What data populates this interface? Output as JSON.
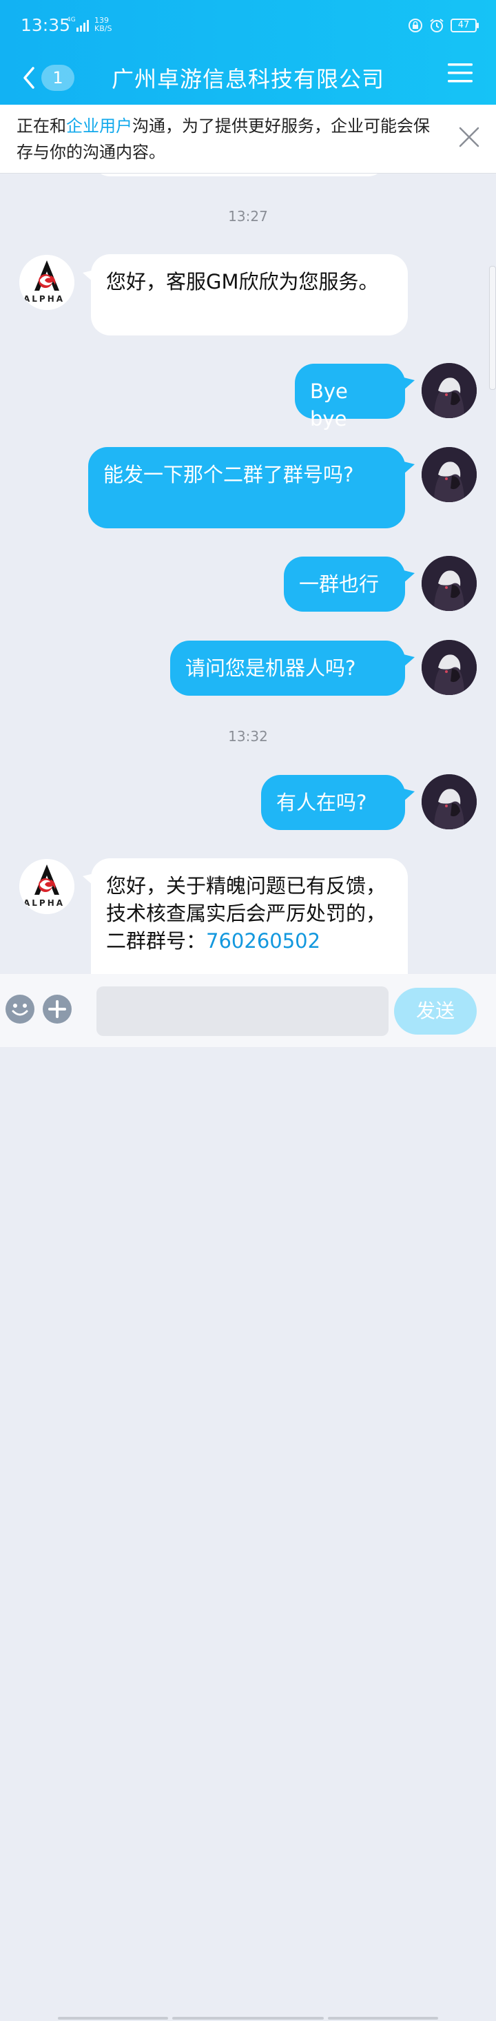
{
  "status_bar": {
    "time": "13:35",
    "network": "4G",
    "speed_value": "139",
    "speed_unit": "KB/S",
    "battery": "47"
  },
  "header": {
    "unread_count": "1",
    "title": "广州卓游信息科技有限公司",
    "color": "#16bdf5"
  },
  "notice": {
    "prefix": "正在和",
    "link": "企业用户",
    "suffix": "沟通，为了提供更好服务，企业可能会保存与你的沟通内容。"
  },
  "messages": {
    "time1": "13:27",
    "m1": "您好，客服GM欣欣为您服务。",
    "m2": "Bye bye",
    "m3": "能发一下那个二群了群号吗?",
    "m4": "一群也行",
    "m5": "请问您是机器人吗?",
    "time2": "13:32",
    "m6": "有人在吗?",
    "m7_text": "您好，关于精魄问题已有反馈，技术核查属实后会严厉处罚的，二群群号：",
    "m7_number": "760260502",
    "alpha_logo": "ALPHA"
  },
  "input_bar": {
    "placeholder": "",
    "send_label": "发送"
  },
  "colors": {
    "bubble_out": "#1fb6f6",
    "bubble_in": "#ffffff",
    "background": "#eaedf4"
  }
}
